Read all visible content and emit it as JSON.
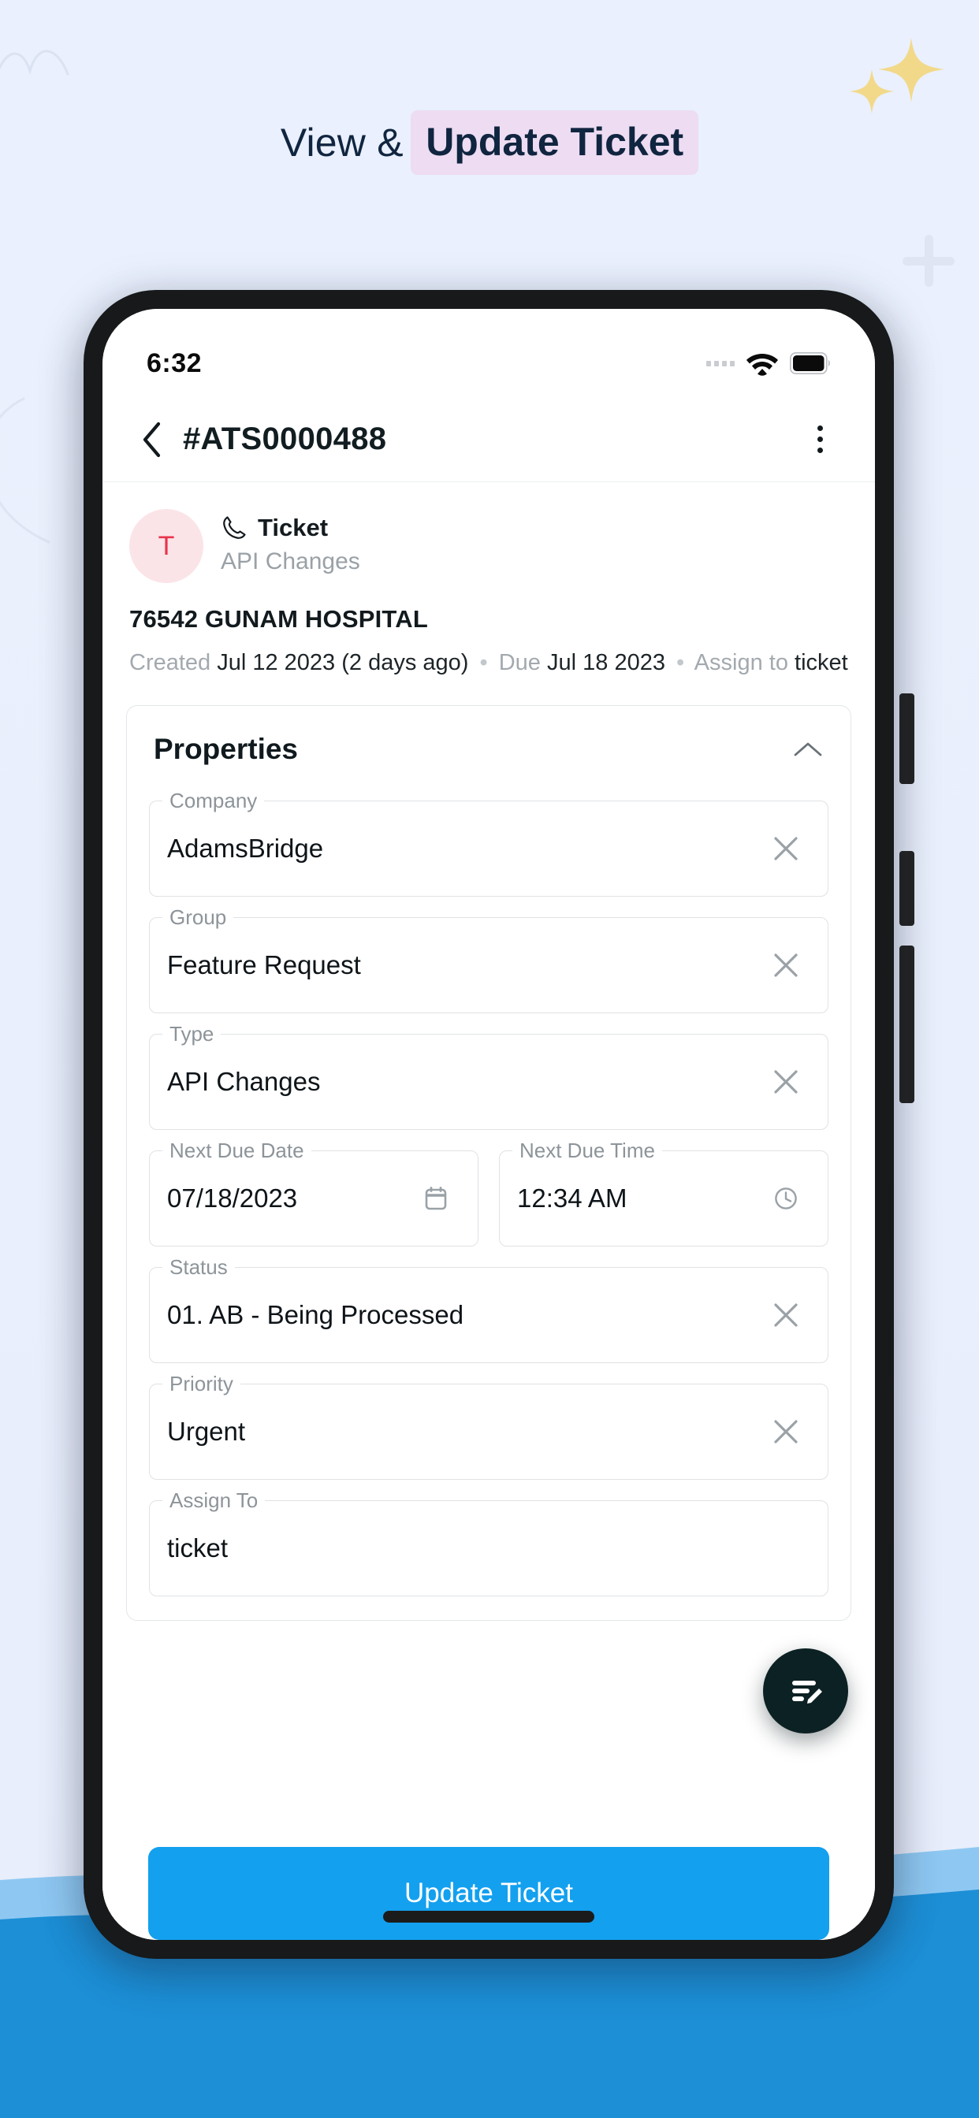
{
  "page": {
    "heading_plain": "View &",
    "heading_highlight": "Update Ticket",
    "highlight_bg": "#eddcf2",
    "bg_color": "#eaf0fd",
    "sparkle_color": "#f2d98a",
    "wave_colors": [
      "#8ec8f2",
      "#1d8fd6",
      "#1b8ed4"
    ]
  },
  "status_bar": {
    "time": "6:32",
    "signal_icon": "signal-dots-icon",
    "wifi_icon": "wifi-icon",
    "battery_icon": "battery-full-icon"
  },
  "app_bar": {
    "back_icon": "chevron-left-icon",
    "title": "#ATS0000488",
    "menu_icon": "kebab-menu-icon"
  },
  "ticket": {
    "avatar_initial": "T",
    "avatar_bg": "#fbe4e8",
    "avatar_color": "#e8334b",
    "channel_icon": "phone-icon",
    "channel": "Ticket",
    "subject": "API Changes",
    "organization": "76542 GUNAM HOSPITAL",
    "meta": {
      "created_label": "Created",
      "created_value": "Jul 12 2023 (2 days ago)",
      "due_label": "Due",
      "due_value": "Jul 18 2023",
      "assign_label": "Assign to",
      "assign_value": "ticket"
    }
  },
  "properties": {
    "title": "Properties",
    "collapse_icon": "chevron-up-icon",
    "fields": [
      {
        "label": "Company",
        "value": "AdamsBridge",
        "action_icon": "close-icon"
      },
      {
        "label": "Group",
        "value": "Feature Request",
        "action_icon": "close-icon"
      },
      {
        "label": "Type",
        "value": "API Changes",
        "action_icon": "close-icon"
      },
      {
        "label": "Next Due Date",
        "value": "07/18/2023",
        "action_icon": "calendar-icon"
      },
      {
        "label": "Next Due Time",
        "value": "12:34 AM",
        "action_icon": "clock-icon"
      },
      {
        "label": "Status",
        "value": "01. AB - Being Processed",
        "action_icon": "close-icon"
      },
      {
        "label": "Priority",
        "value": "Urgent",
        "action_icon": "close-icon"
      },
      {
        "label": "Assign To",
        "value": "ticket",
        "action_icon": ""
      }
    ]
  },
  "fab": {
    "icon": "edit-note-icon",
    "bg": "#0c2124"
  },
  "primary_button": {
    "label": "Update Ticket",
    "bg": "#13a0ef"
  }
}
